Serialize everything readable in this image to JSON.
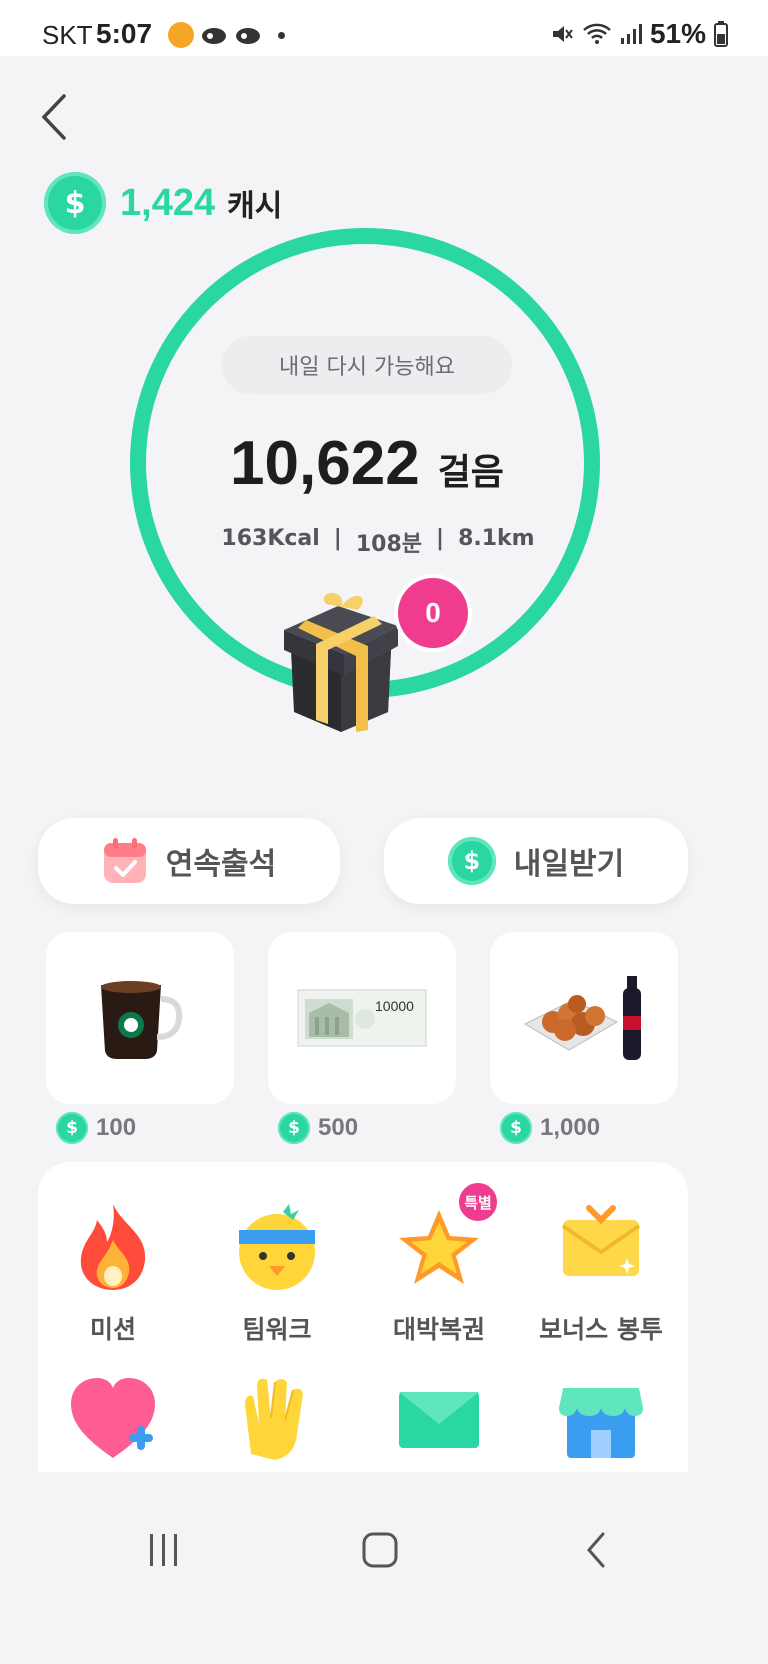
{
  "status_bar": {
    "carrier": "SKT",
    "time": "5:07",
    "battery": "51%"
  },
  "header": {
    "cash_amount": "1,424",
    "cash_unit": "캐시"
  },
  "steps": {
    "message": "내일 다시 가능해요",
    "count": "10,622",
    "unit": "걸음",
    "calories": "163Kcal",
    "minutes": "108분",
    "distance": "8.1km",
    "separator": "|",
    "gift_count": "0"
  },
  "actions": {
    "attendance_label": "연속출석",
    "tomorrow_label": "내일받기"
  },
  "rewards": [
    {
      "name": "coffee",
      "price": "100"
    },
    {
      "name": "gift-voucher",
      "price": "500"
    },
    {
      "name": "chicken-set",
      "price": "1,000",
      "voucher_text": "10000"
    }
  ],
  "voucher_text": "10000",
  "coin_symbol": "$",
  "menu": [
    {
      "label": "미션",
      "icon": "fire-icon"
    },
    {
      "label": "팀워크",
      "icon": "chick-headband-icon"
    },
    {
      "label": "대박복권",
      "icon": "star-icon",
      "badge": "특별"
    },
    {
      "label": "보너스 봉투",
      "icon": "gift-envelope-icon"
    },
    {
      "label": "",
      "icon": "heart-plus-icon"
    },
    {
      "label": "",
      "icon": "clapping-hands-icon"
    },
    {
      "label": "",
      "icon": "mail-icon"
    },
    {
      "label": "",
      "icon": "store-icon"
    }
  ],
  "colors": {
    "accent": "#2ad6a2",
    "badge": "#f03c8e",
    "background": "#f4f4f6"
  }
}
